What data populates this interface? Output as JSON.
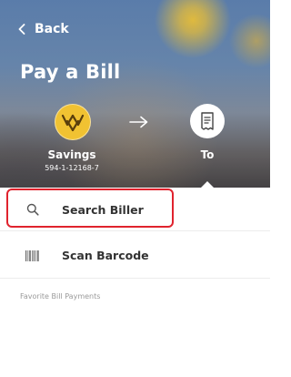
{
  "header": {
    "back_label": "Back",
    "title": "Pay a Bill"
  },
  "transfer": {
    "from_name": "Savings",
    "from_account": "594-1-12168-7",
    "to_label": "To"
  },
  "options": [
    {
      "label": "Search Biller",
      "icon": "search-icon",
      "highlighted": true
    },
    {
      "label": "Scan Barcode",
      "icon": "barcode-icon",
      "highlighted": false
    }
  ],
  "favorites": {
    "section_label": "Favorite Bill Payments"
  },
  "colors": {
    "highlight_border": "#e0232e",
    "bank_logo": "#f1c232"
  }
}
